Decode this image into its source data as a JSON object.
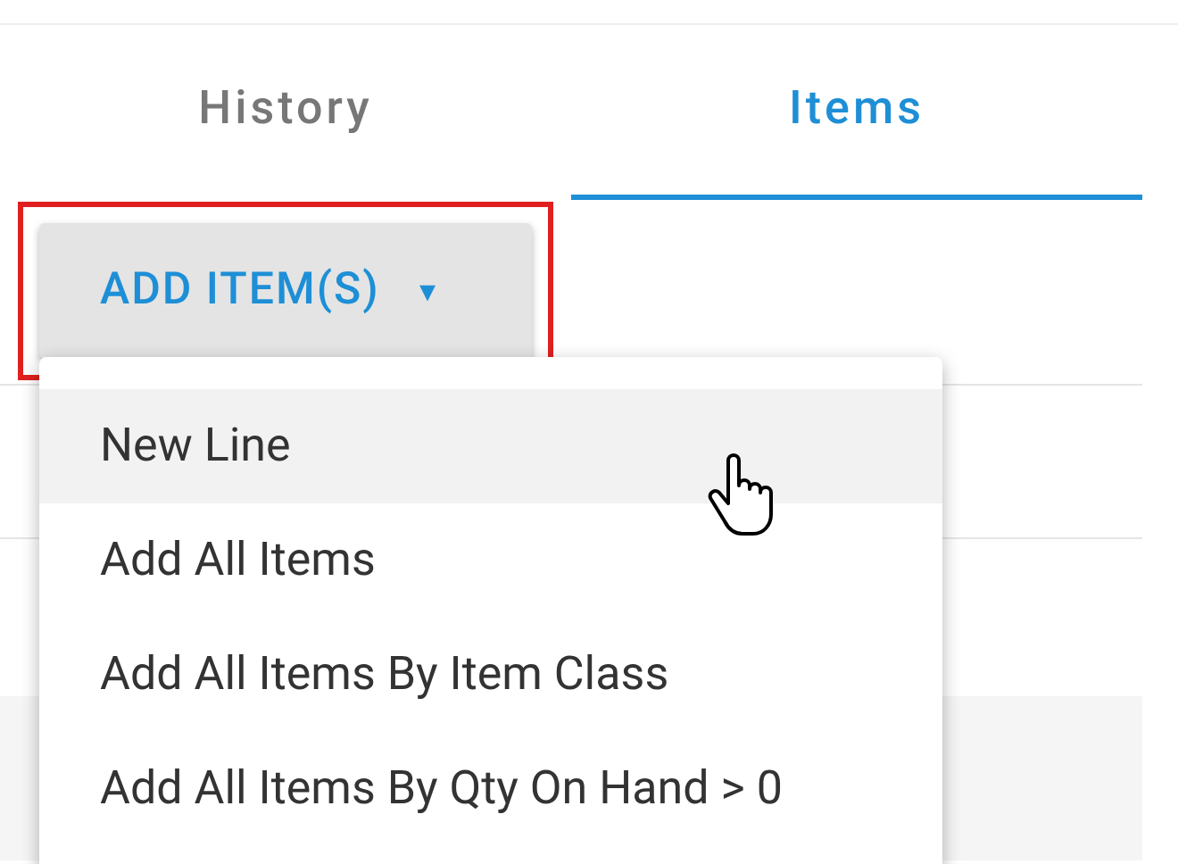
{
  "tabs": [
    {
      "label": "History",
      "selected": false
    },
    {
      "label": "Items",
      "selected": true
    }
  ],
  "add_button": {
    "label": "ADD ITEM(S)",
    "caret": "▾",
    "highlighted": true
  },
  "menu": {
    "items": [
      {
        "label": "New Line",
        "hovered": true
      },
      {
        "label": "Add All Items",
        "hovered": false
      },
      {
        "label": "Add All Items By Item Class",
        "hovered": false
      },
      {
        "label": "Add All Items By Qty On Hand > 0",
        "hovered": false
      }
    ]
  }
}
